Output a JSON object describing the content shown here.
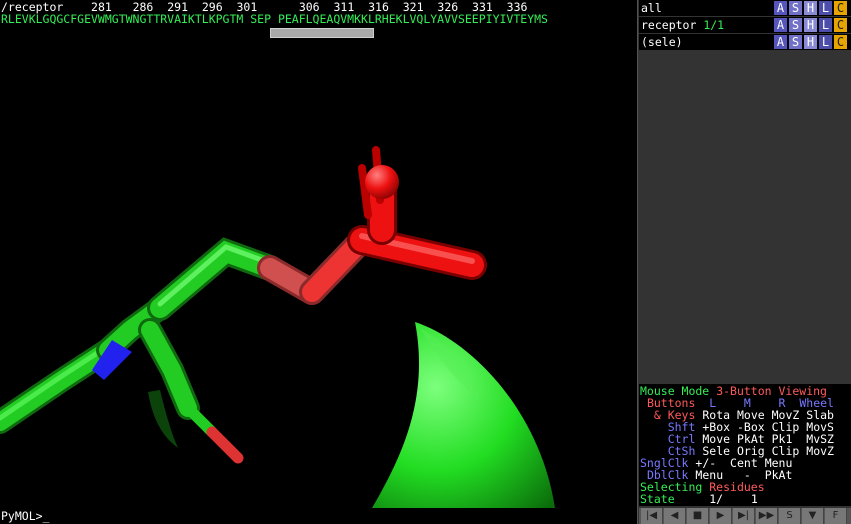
{
  "sequence": {
    "object_label": "/receptor",
    "residue_numbers": [
      "281",
      "286",
      "291",
      "296",
      "301",
      "306",
      "311",
      "316",
      "321",
      "326",
      "331",
      "336"
    ],
    "letters": "RLEVKLGQGCFGEVWMGTWNGTTRVAIKTLKPGTM SEP PEAFLQEAQVMKKLRHEKLVQLYAVVSEEPIYIVTEYMS"
  },
  "command_line": {
    "prompt": "PyMOL>_"
  },
  "objects": [
    {
      "name": "all",
      "state": "",
      "buttons": [
        "A",
        "S",
        "H",
        "L",
        "C"
      ]
    },
    {
      "name": "receptor",
      "state": "1/1",
      "buttons": [
        "A",
        "S",
        "H",
        "L",
        "C"
      ]
    },
    {
      "name": "(sele)",
      "state": "",
      "buttons": [
        "A",
        "S",
        "H",
        "L",
        "C"
      ]
    }
  ],
  "mouse_panel": {
    "mode_label": "Mouse Mode",
    "mode_value": "3-Button Viewing",
    "header": {
      "buttons": "Buttons",
      "l": "L",
      "m": "M",
      "r": "R",
      "wheel": "Wheel"
    },
    "rows": [
      {
        "key": "& Keys",
        "l": "Rota",
        "m": "Move",
        "r": "MovZ",
        "w": "Slab"
      },
      {
        "key": "Shft",
        "l": "+Box",
        "m": "-Box",
        "r": "Clip",
        "w": "MovS"
      },
      {
        "key": "Ctrl",
        "l": "Move",
        "m": "PkAt",
        "r": "Pk1",
        "w": "MvSZ"
      },
      {
        "key": "CtSh",
        "l": "Sele",
        "m": "Orig",
        "r": "Clip",
        "w": "MovZ"
      }
    ],
    "single_click": {
      "key": "SnglClk",
      "l": "+/-",
      "m": "Cent",
      "r": "Menu"
    },
    "double_click": {
      "key": "DblClk",
      "l": "Menu",
      "m": "-",
      "r": "PkAt"
    },
    "selecting": {
      "label": "Selecting",
      "value": "Residues"
    },
    "state": {
      "label": "State",
      "current": "1/",
      "total": "1"
    }
  },
  "transport": {
    "icons": [
      "rewind-icon",
      "step-back-icon",
      "stop-icon",
      "play-icon",
      "step-forward-icon",
      "fast-forward-icon",
      "scene-icon",
      "menu-down-icon",
      "full-screen-icon"
    ],
    "labels": [
      "|◀",
      "◀",
      "■",
      "▶",
      "▶|",
      "▶▶",
      "S",
      "▼",
      "F"
    ]
  },
  "colors": {
    "background": "#000000",
    "carbon": "#22dd22",
    "oxygen": "#ee1111",
    "nitrogen": "#2222ee",
    "ui_green": "#33ee55",
    "ui_red": "#ff5a5a",
    "ui_blue": "#7878ff"
  }
}
